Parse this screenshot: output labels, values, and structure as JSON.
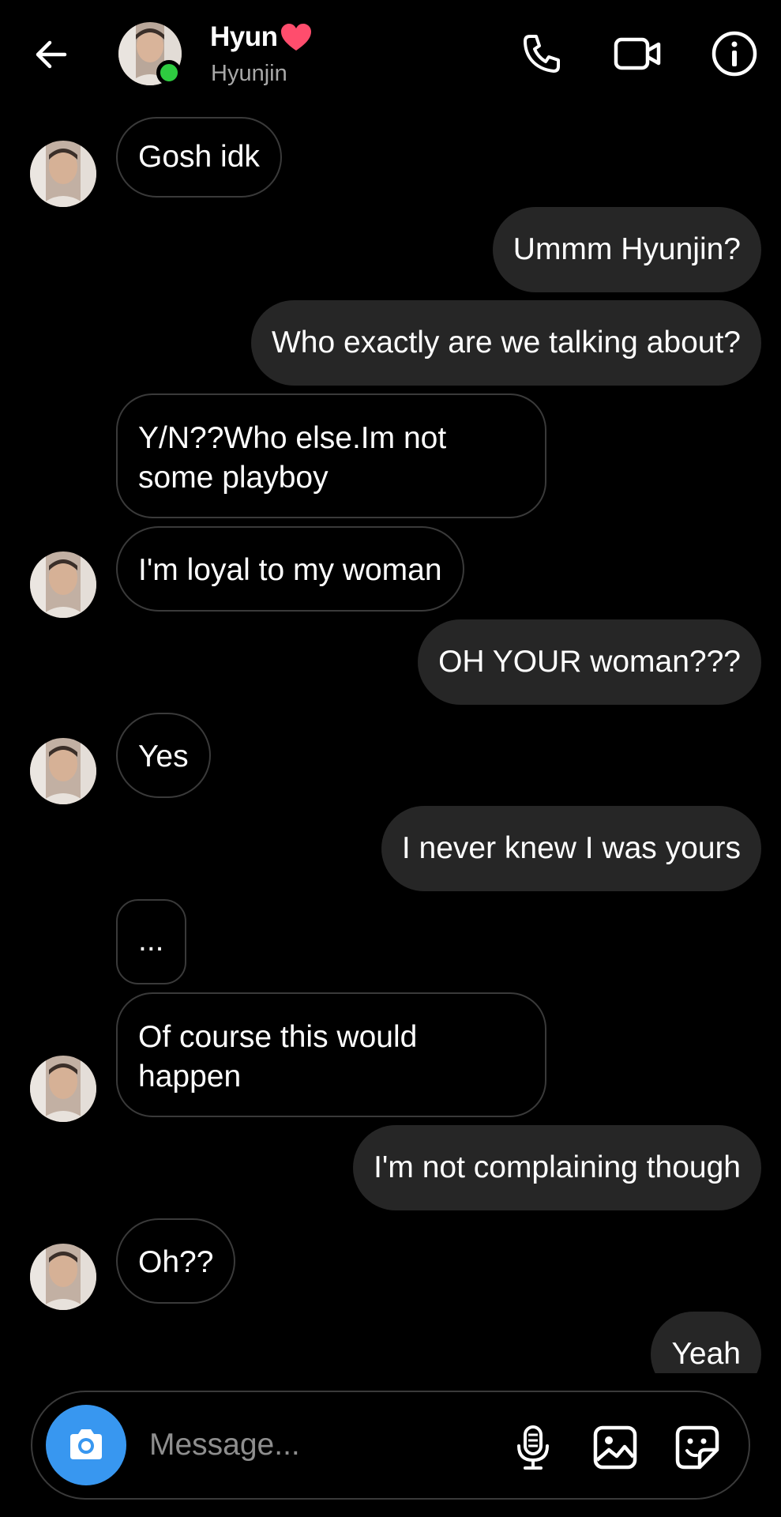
{
  "header": {
    "name": "Hyun",
    "username": "Hyunjin"
  },
  "messages": [
    {
      "dir": "in",
      "text": "Gosh idk"
    },
    {
      "dir": "out",
      "text": "Ummm Hyunjin?"
    },
    {
      "dir": "out",
      "text": "Who exactly are we talking about?"
    },
    {
      "dir": "in",
      "lines": [
        "Y/N??Who else.Im not",
        "some playboy"
      ]
    },
    {
      "dir": "in",
      "text": "I'm loyal to my woman"
    },
    {
      "dir": "out",
      "text": "OH YOUR woman???"
    },
    {
      "dir": "in",
      "text": "Yes"
    },
    {
      "dir": "out",
      "text": "I never  knew I was yours"
    },
    {
      "dir": "in",
      "text": "..."
    },
    {
      "dir": "in",
      "lines": [
        "Of course this would",
        "happen"
      ]
    },
    {
      "dir": "out",
      "text": "I'm not complaining though"
    },
    {
      "dir": "in",
      "text": "Oh??"
    },
    {
      "dir": "out",
      "text": "Yeah"
    }
  ],
  "composer": {
    "placeholder": "Message..."
  },
  "colors": {
    "accent": "#3897f0",
    "online": "#2ecc40",
    "outgoing_bubble": "#262626",
    "heart": "#ff4d6d"
  }
}
